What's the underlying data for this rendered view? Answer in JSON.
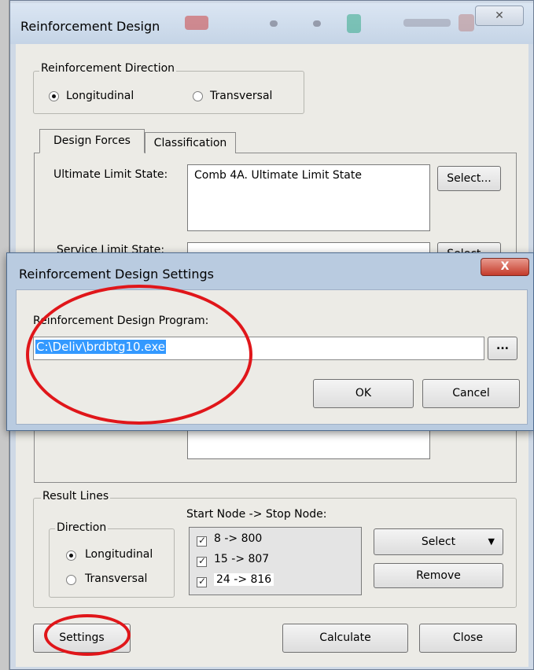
{
  "main_window": {
    "title": "Reinforcement Design",
    "close_glyph": "✕"
  },
  "reinforcement_direction": {
    "legend": "Reinforcement Direction",
    "options": [
      {
        "label": "Longitudinal",
        "selected": true
      },
      {
        "label": "Transversal",
        "selected": false
      }
    ]
  },
  "tabs": [
    {
      "label": "Design Forces",
      "active": true
    },
    {
      "label": "Classification",
      "active": false
    }
  ],
  "design_forces": {
    "uls_label": "Ultimate Limit State:",
    "uls_value": "Comb 4A. Ultimate Limit State",
    "uls_select": "Select...",
    "sls_label": "Service Limit State:",
    "sls_select": "Select..."
  },
  "result_lines": {
    "legend": "Result Lines",
    "direction_legend": "Direction",
    "direction_options": [
      {
        "label": "Longitudinal",
        "selected": true
      },
      {
        "label": "Transversal",
        "selected": false
      }
    ],
    "nodes_header": "Start Node -> Stop Node:",
    "nodes": [
      {
        "label": "8 -> 800",
        "checked": true
      },
      {
        "label": "15 -> 807",
        "checked": true
      },
      {
        "label": "24 -> 816",
        "checked": true
      }
    ],
    "select_button": "Select",
    "remove_button": "Remove"
  },
  "footer": {
    "settings": "Settings",
    "calculate": "Calculate",
    "close": "Close"
  },
  "dialog": {
    "title": "Reinforcement Design Settings",
    "close_glyph": "X",
    "program_label": "Reinforcement Design Program:",
    "program_path": "C:\\Deliv\\brdbtg10.exe",
    "browse_label": "...",
    "ok_label": "OK",
    "cancel_label": "Cancel"
  },
  "colors": {
    "highlight": "#3399ff",
    "annotation": "#e0161a"
  }
}
